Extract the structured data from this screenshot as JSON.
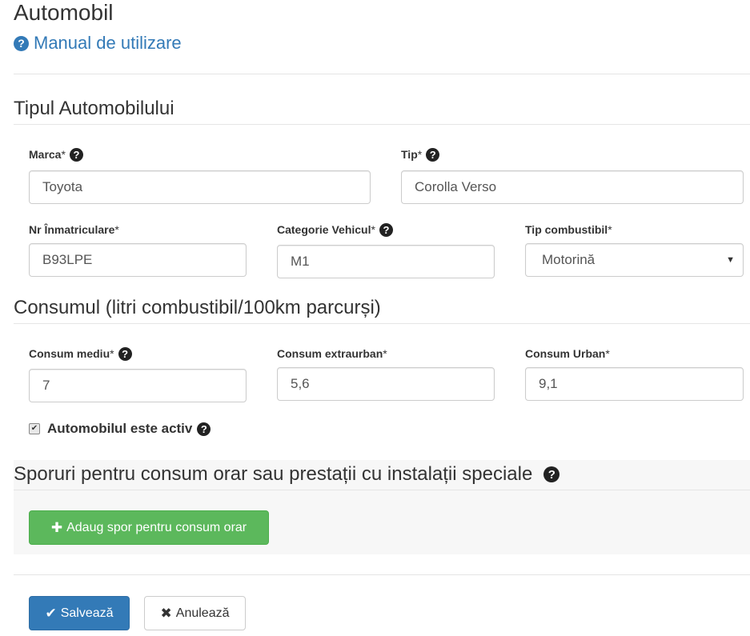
{
  "header": {
    "title": "Automobil",
    "manual_link": "Manual de utilizare"
  },
  "sections": {
    "tip": "Tipul Automobilului",
    "consum": "Consumul (litri combustibil/100km parcurși)",
    "sporuri": "Sporuri pentru consum orar sau prestații cu instalații speciale"
  },
  "fields": {
    "marca": {
      "label": "Marca",
      "value": "Toyota"
    },
    "tip": {
      "label": "Tip",
      "value": "Corolla Verso"
    },
    "nr": {
      "label": "Nr Înmatriculare",
      "value": "B93LPE"
    },
    "categorie": {
      "label": "Categorie Vehicul",
      "value": "M1"
    },
    "combustibil": {
      "label": "Tip combustibil",
      "value": "Motorină"
    },
    "consum_mediu": {
      "label": "Consum mediu",
      "value": "7"
    },
    "consum_extraurban": {
      "label": "Consum extraurban",
      "value": "5,6"
    },
    "consum_urban": {
      "label": "Consum Urban",
      "value": "9,1"
    }
  },
  "required_mark": "*",
  "help_glyph": "?",
  "active": {
    "label": "Automobilul este activ",
    "checked": true
  },
  "buttons": {
    "add_spor": "Adaug spor pentru consum orar",
    "save": "Salvează",
    "cancel": "Anulează"
  },
  "icons": {
    "help": "question-circle-icon",
    "plus": "plus-icon",
    "check": "check-icon",
    "times": "times-icon",
    "caret": "caret-down-icon"
  },
  "colors": {
    "link": "#337ab7",
    "success": "#5cb85c",
    "primary": "#337ab7"
  }
}
